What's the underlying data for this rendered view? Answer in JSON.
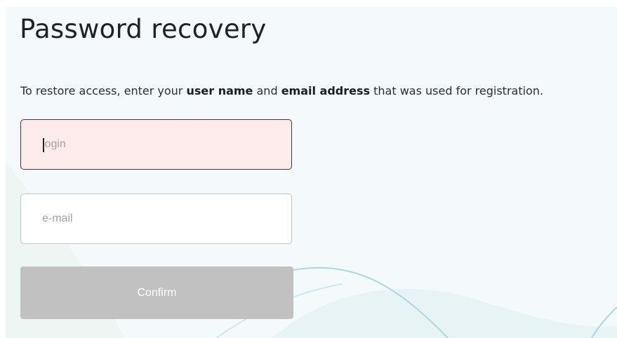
{
  "page": {
    "title": "Password recovery",
    "intro": {
      "part1": "To restore access, enter your ",
      "bold1": "user name",
      "part2": " and ",
      "bold2": "email address",
      "part3": " that was used for registration."
    }
  },
  "form": {
    "login": {
      "placeholder": "login",
      "value": ""
    },
    "email": {
      "placeholder": "e-mail",
      "value": ""
    },
    "confirm_label": "Confirm"
  },
  "colors": {
    "panel_background": "#f4fafb",
    "login_invalid_background": "#fdebeb",
    "button_disabled": "#c1c1c1",
    "wave_accent": "#a9d8e3"
  }
}
